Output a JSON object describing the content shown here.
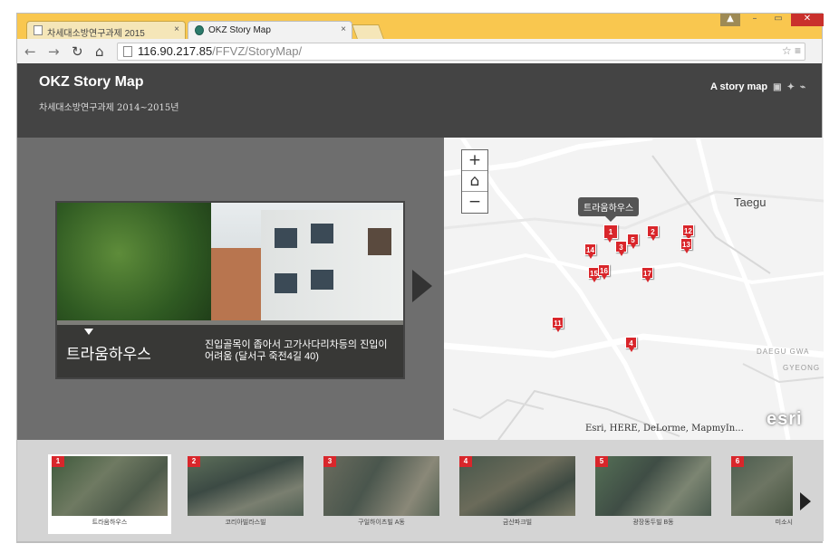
{
  "browser": {
    "tabs": [
      {
        "label": "차세대소방연구과제 2015",
        "active": false
      },
      {
        "label": "OKZ Story Map",
        "active": true
      }
    ],
    "address_host": "116.90.217.85",
    "address_path": "/FFVZ/StoryMap/"
  },
  "app": {
    "title": "OKZ Story Map",
    "subtitle": "차세대소방연구과제 2014~2015년",
    "header_link": "A story map"
  },
  "current": {
    "name": "트라움하우스",
    "description": "진입골목이 좁아서 고가사다리차등의 진입이 어려움 (달서구 죽전4길 40)"
  },
  "map": {
    "city_label": "Taegu",
    "tooltip": "트라움하우스",
    "road_label_1": "DAEGU GWA",
    "road_label_2": "GYEONG",
    "attribution": "Esri, HERE, DeLorme, MapmyIn...",
    "logo": "esri",
    "markers": [
      "1",
      "2",
      "3",
      "4",
      "5",
      "11",
      "12",
      "13",
      "14",
      "15",
      "16",
      "17"
    ]
  },
  "carousel": {
    "items": [
      {
        "num": "1",
        "label": "트라움하우스"
      },
      {
        "num": "2",
        "label": "코리아빌라스빌"
      },
      {
        "num": "3",
        "label": "구일하이츠빌 A동"
      },
      {
        "num": "4",
        "label": "금산파크빌"
      },
      {
        "num": "5",
        "label": "광장동두빌 B동"
      },
      {
        "num": "6",
        "label": "미소시"
      }
    ]
  },
  "colors": {
    "header": "#444444",
    "panel": "#6e6e6e",
    "marker": "#d9262b",
    "carousel": "#d4d4d4"
  }
}
